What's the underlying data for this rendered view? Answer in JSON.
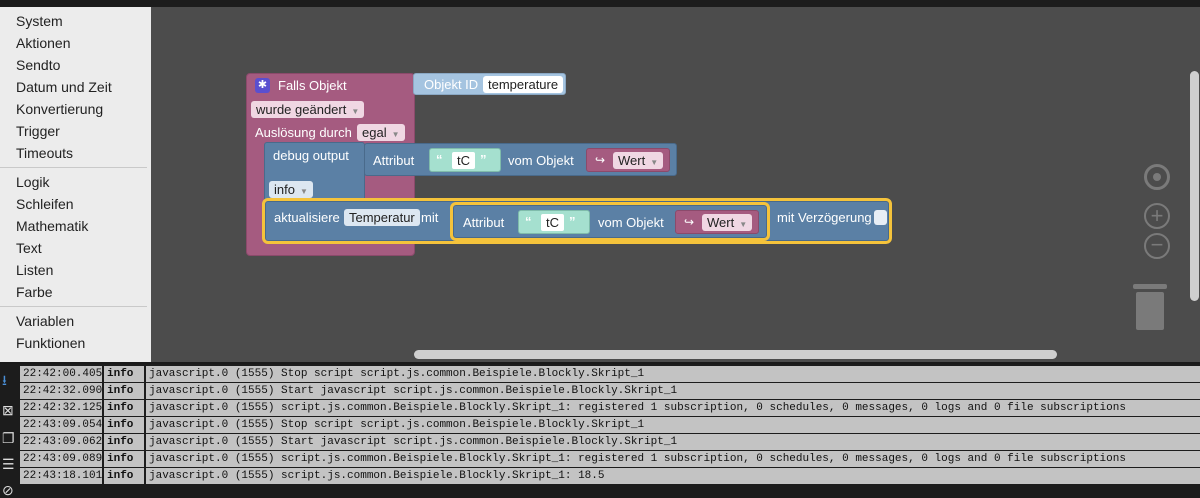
{
  "toolbox": {
    "groups": [
      [
        "System",
        "Aktionen",
        "Sendto",
        "Datum und Zeit",
        "Konvertierung",
        "Trigger",
        "Timeouts"
      ],
      [
        "Logik",
        "Schleifen",
        "Mathematik",
        "Text",
        "Listen",
        "Farbe"
      ],
      [
        "Variablen",
        "Funktionen"
      ]
    ]
  },
  "blocks": {
    "event": {
      "title": "Falls Objekt",
      "changed": "wurde geändert",
      "trigger_label": "Auslösung durch",
      "trigger_value": "egal"
    },
    "object_id": {
      "label": "Objekt ID",
      "value": "temperature"
    },
    "debug": {
      "label": "debug output",
      "level": "info",
      "attr_label": "Attribut",
      "attr_value": "tC",
      "from_label": "vom Objekt",
      "value_label": "Wert"
    },
    "update": {
      "label": "aktualisiere",
      "variable": "Temperatur",
      "with_label": "mit",
      "attr_label": "Attribut",
      "attr_value": "tC",
      "from_label": "vom Objekt",
      "value_label": "Wert",
      "delay_label": "mit Verzögerung"
    },
    "quote_open": "“",
    "quote_close": "”"
  },
  "log": {
    "rows": [
      {
        "time": "22:42:00.405",
        "level": "info",
        "msg": "javascript.0 (1555) Stop script script.js.common.Beispiele.Blockly.Skript_1"
      },
      {
        "time": "22:42:32.090",
        "level": "info",
        "msg": "javascript.0 (1555) Start javascript script.js.common.Beispiele.Blockly.Skript_1"
      },
      {
        "time": "22:42:32.125",
        "level": "info",
        "msg": "javascript.0 (1555) script.js.common.Beispiele.Blockly.Skript_1: registered 1 subscription, 0 schedules, 0 messages, 0 logs and 0 file subscriptions"
      },
      {
        "time": "22:43:09.054",
        "level": "info",
        "msg": "javascript.0 (1555) Stop script script.js.common.Beispiele.Blockly.Skript_1"
      },
      {
        "time": "22:43:09.062",
        "level": "info",
        "msg": "javascript.0 (1555) Start javascript script.js.common.Beispiele.Blockly.Skript_1"
      },
      {
        "time": "22:43:09.089",
        "level": "info",
        "msg": "javascript.0 (1555) script.js.common.Beispiele.Blockly.Skript_1: registered 1 subscription, 0 schedules, 0 messages, 0 logs and 0 file subscriptions"
      },
      {
        "time": "22:43:18.101",
        "level": "info",
        "msg": "javascript.0 (1555) script.js.common.Beispiele.Blockly.Skript_1: 18.5"
      }
    ]
  },
  "icons": {
    "scroll_down": "arrow-down-icon",
    "clear": "trash-x-icon",
    "copy": "copy-icon",
    "filter": "list-icon",
    "hide": "eye-off-icon"
  }
}
